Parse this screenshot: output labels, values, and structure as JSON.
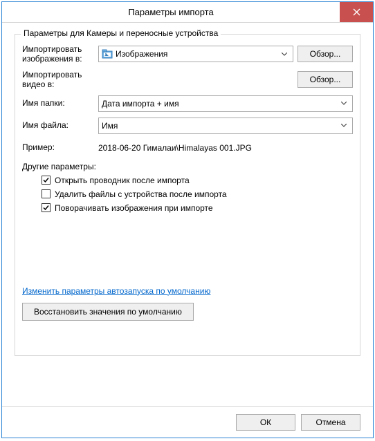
{
  "title": "Параметры импорта",
  "groupbox_title": "Параметры для Камеры и переносные устройства",
  "rows": {
    "import_images_label": "Импортировать изображения в:",
    "import_images_value": "Изображения",
    "import_images_browse": "Обзор...",
    "import_video_label": "Импортировать видео в:",
    "import_video_browse": "Обзор...",
    "folder_name_label": "Имя папки:",
    "folder_name_value": "Дата импорта + имя",
    "file_name_label": "Имя файла:",
    "file_name_value": "Имя",
    "example_label": "Пример:",
    "example_value": "2018-06-20 Гималаи\\Himalayas 001.JPG"
  },
  "other_options_label": "Другие параметры:",
  "checkboxes": [
    {
      "label": "Открыть проводник после импорта",
      "checked": true
    },
    {
      "label": "Удалить файлы с устройства после импорта",
      "checked": false
    },
    {
      "label": "Поворачивать изображения при импорте",
      "checked": true
    }
  ],
  "link_text": "Изменить параметры автозапуска по умолчанию",
  "restore_button": "Восстановить значения по умолчанию",
  "footer": {
    "ok": "ОК",
    "cancel": "Отмена"
  }
}
